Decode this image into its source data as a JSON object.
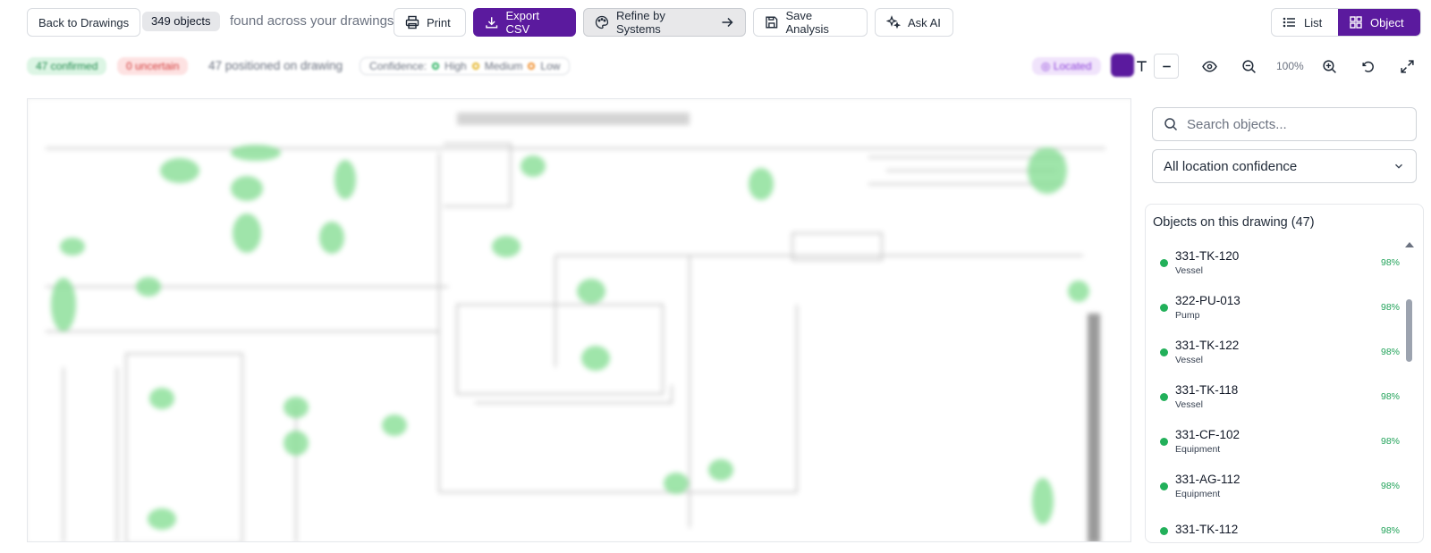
{
  "toolbar": {
    "back_label": "Back to Drawings",
    "objects_count": "349 objects",
    "found_text": "found across your drawings",
    "print_label": "Print",
    "export_label": "Export CSV",
    "refine_label": "Refine by Systems",
    "save_label": "Save Analysis",
    "ask_ai_label": "Ask AI",
    "view_list_label": "List",
    "view_object_label": "Object",
    "accent_color": "#5b1a9e"
  },
  "status": {
    "confirmed": "47 confirmed",
    "uncertain": "0 uncertain",
    "positioned": "47 positioned on drawing",
    "confidence_label": "Confidence:",
    "high": "High",
    "medium": "Medium",
    "low": "Low",
    "located": "Located"
  },
  "viewer": {
    "zoom": "100%"
  },
  "sidebar": {
    "search_placeholder": "Search objects...",
    "filter_value": "All location confidence",
    "panel_title": "Objects on this drawing (47)",
    "items": [
      {
        "id": "331-TK-120",
        "type": "Vessel",
        "confidence": "98%"
      },
      {
        "id": "322-PU-013",
        "type": "Pump",
        "confidence": "98%"
      },
      {
        "id": "331-TK-122",
        "type": "Vessel",
        "confidence": "98%"
      },
      {
        "id": "331-TK-118",
        "type": "Vessel",
        "confidence": "98%"
      },
      {
        "id": "331-CF-102",
        "type": "Equipment",
        "confidence": "98%"
      },
      {
        "id": "331-AG-112",
        "type": "Equipment",
        "confidence": "98%"
      },
      {
        "id": "331-TK-112",
        "type": "",
        "confidence": "98%"
      }
    ]
  }
}
